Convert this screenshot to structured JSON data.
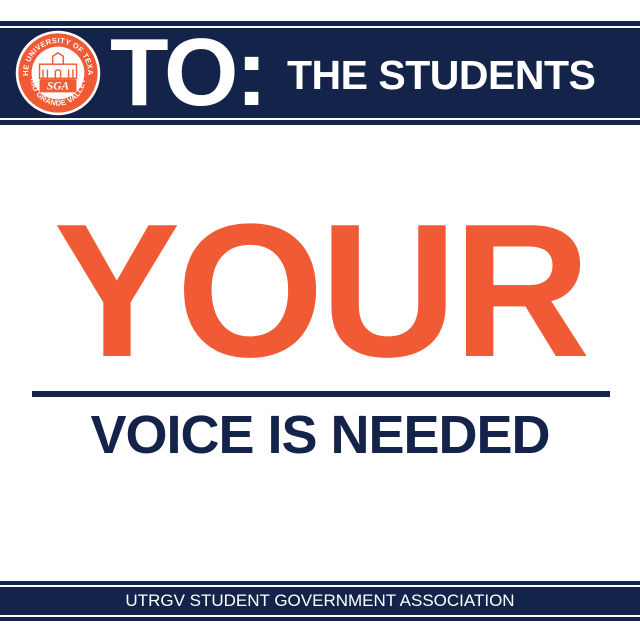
{
  "header": {
    "to_label": "TO:",
    "recipient": "THE STUDENTS",
    "seal": {
      "top_text": "THE UNIVERSITY OF TEXAS",
      "bottom_text": "RIO GRANDE VALLEY",
      "monogram": "SGA"
    }
  },
  "main": {
    "headline": "YOUR",
    "subline": "VOICE IS NEEDED"
  },
  "footer": {
    "organization": "UTRGV STUDENT GOVERNMENT ASSOCIATION"
  },
  "colors": {
    "navy": "#14234a",
    "orange": "#f05a35",
    "white": "#ffffff"
  }
}
